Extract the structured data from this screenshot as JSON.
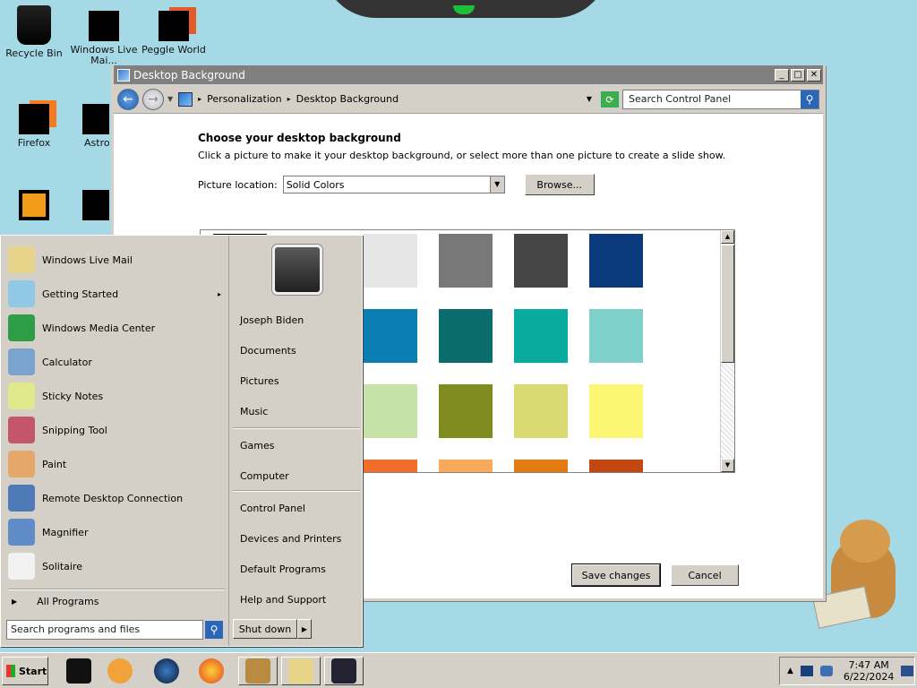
{
  "desktop": {
    "icons": [
      {
        "label": "Recycle Bin"
      },
      {
        "label": "Windows Live Mai..."
      },
      {
        "label": "Peggle World"
      },
      {
        "label": "Firefox"
      },
      {
        "label": "Astro Delux"
      }
    ]
  },
  "window": {
    "title": "Desktop Background",
    "controls": {
      "minimize": "_",
      "maximize": "□",
      "close": "✕"
    },
    "address": {
      "crumb1": "Personalization",
      "crumb2": "Desktop Background"
    },
    "search_placeholder": "Search Control Panel",
    "heading": "Choose your desktop background",
    "description": "Click a picture to make it your desktop background, or select more than one picture to create a slide show.",
    "picture_location_label": "Picture location:",
    "picture_location_value": "Solid Colors",
    "browse_label": "Browse...",
    "save_label": "Save changes",
    "cancel_label": "Cancel",
    "swatch_colors": [
      "#000000",
      "#e6e6e6",
      "#787878",
      "#454545",
      "#0b3b7c",
      "#1f65a0",
      "#0b7eb2",
      "#0b6c6e",
      "#0aab9f",
      "#7fcfcb",
      "#a8d48e",
      "#c6e2a6",
      "#7f8b1f",
      "#d9da72",
      "#fbf774",
      "#d54a1f",
      "#f36d2a",
      "#f9a957",
      "#e47b12",
      "#c4470f"
    ]
  },
  "start_menu": {
    "programs": [
      {
        "label": "Windows Live Mail",
        "icon": "mail-icon",
        "color": "#e8d38a"
      },
      {
        "label": "Getting Started",
        "icon": "getting-started-icon",
        "color": "#8fc9e6",
        "submenu": "▸"
      },
      {
        "label": "Windows Media Center",
        "icon": "media-center-icon",
        "color": "#2e9d46"
      },
      {
        "label": "Calculator",
        "icon": "calculator-icon",
        "color": "#7aa4cf"
      },
      {
        "label": "Sticky Notes",
        "icon": "sticky-notes-icon",
        "color": "#dfe88a"
      },
      {
        "label": "Snipping Tool",
        "icon": "scissors-icon",
        "color": "#c4566a"
      },
      {
        "label": "Paint",
        "icon": "paint-icon",
        "color": "#e6a86a"
      },
      {
        "label": "Remote Desktop Connection",
        "icon": "remote-desktop-icon",
        "color": "#4f7ab8"
      },
      {
        "label": "Magnifier",
        "icon": "magnifier-icon",
        "color": "#5f8cc8"
      },
      {
        "label": "Solitaire",
        "icon": "cards-icon",
        "color": "#f2f2f2"
      }
    ],
    "all_programs": "All Programs",
    "search_placeholder": "Search programs and files",
    "right_links": [
      {
        "label": "Joseph Biden"
      },
      {
        "label": "Documents"
      },
      {
        "label": "Pictures"
      },
      {
        "label": "Music"
      },
      {
        "label": "Games"
      },
      {
        "label": "Computer"
      },
      {
        "label": "Control Panel"
      },
      {
        "label": "Devices and Printers"
      },
      {
        "label": "Default Programs"
      },
      {
        "label": "Help and Support"
      }
    ],
    "shutdown_label": "Shut down"
  },
  "taskbar": {
    "start_label": "Start",
    "clock_time": "7:47 AM",
    "clock_date": "6/22/2024"
  }
}
